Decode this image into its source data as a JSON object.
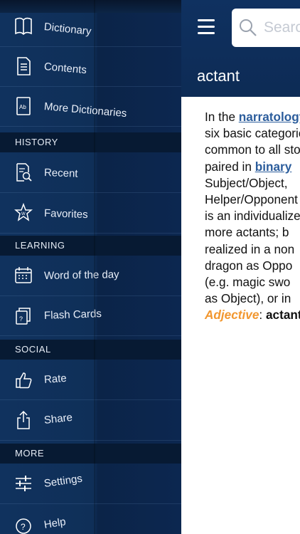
{
  "sidebar": {
    "items": [
      {
        "label": "Dictionary",
        "icon": "book-icon"
      },
      {
        "label": "Contents",
        "icon": "document-list-icon"
      },
      {
        "label": "More Dictionaries",
        "icon": "dictionary-ab-icon"
      },
      {
        "label": "Recent",
        "icon": "recent-search-icon"
      },
      {
        "label": "Favorites",
        "icon": "star-icon"
      },
      {
        "label": "Word of the day",
        "icon": "calendar-icon"
      },
      {
        "label": "Flash Cards",
        "icon": "flash-cards-icon"
      },
      {
        "label": "Rate",
        "icon": "thumbs-up-icon"
      },
      {
        "label": "Share",
        "icon": "share-icon"
      },
      {
        "label": "Settings",
        "icon": "sliders-icon"
      },
      {
        "label": "Help",
        "icon": "help-icon"
      }
    ],
    "sections": {
      "history": "HISTORY",
      "learning": "LEARNING",
      "social": "SOCIAL",
      "more": "MORE"
    }
  },
  "header": {
    "search_placeholder": "Search",
    "entry_title": "actant"
  },
  "article": {
    "l1_pre": "In the ",
    "l1_link": "narratology",
    "l2": "six basic categories",
    "l3": "common to all stories",
    "l4_pre": "paired in ",
    "l4_link": "binary",
    "l5": "Subject/Object,",
    "l6": "Helper/Opponent",
    "l7": "is an individualized",
    "l8": "more actants; b",
    "l9": "realized in a non",
    "l10": "dragon as Oppo",
    "l11": "(e.g. magic swo",
    "l12": "as Object), or in",
    "l13_pos": "Adjective",
    "l13_sep": ": ",
    "l13_word": "actantial"
  },
  "colors": {
    "sidebar_bg": "#10325e",
    "section_bg": "#071a33",
    "link": "#2c5d9c",
    "part_of_speech": "#f2972f"
  }
}
